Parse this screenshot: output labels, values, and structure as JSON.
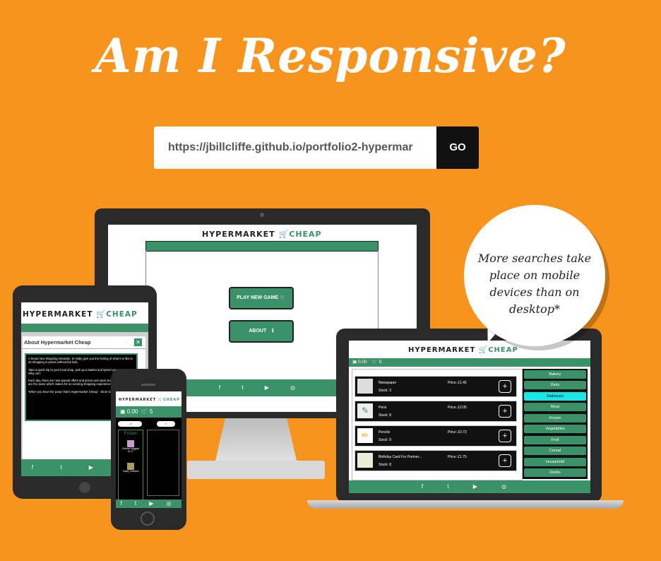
{
  "header": {
    "title": "Am I Responsive?"
  },
  "url_bar": {
    "value": "https://jbillcliffe.github.io/portfolio2-hypermar",
    "go_label": "GO"
  },
  "bubble": {
    "text": "More searches take place on mobile devices than on desktop*"
  },
  "site": {
    "logo_main": "HYPERMARKET",
    "logo_cheap": "CHEAP",
    "play_button": "PLAY NEW GAME",
    "about_button": "ABOUT",
    "footer_icons": "f  t  ▶  ◎"
  },
  "tablet": {
    "modal_title": "About Hypermarket Cheap",
    "modal_p1": "A brand new shopping simulator, to really give you the feeling of what it is like to do shopping in pesos without the kids.",
    "modal_p2": "Take a quick trip to your local shop, pick up a basket and spend your money... Why not?",
    "modal_p3": "Each day, there are new special offers and prices and stock levels. No two days are the same which makes for an exciting shopping experience!",
    "modal_p4": "'When you hear the 'peep' that's Hypermarket Cheap' - Store General Manager"
  },
  "phone": {
    "money": "0.00",
    "cart_count": "5",
    "category": "Frozen",
    "item1": "Chicken Nuggets",
    "item1_price": "£1.47",
    "item2": "Turkey Twizzlers"
  },
  "laptop": {
    "money": "0.00",
    "cart_count": "0",
    "products": [
      {
        "name": "Newspaper",
        "price": "Price: £1.45",
        "stock": "Stock: 3"
      },
      {
        "name": "Pens",
        "price": "Price: £2.05",
        "stock": "Stock: 8"
      },
      {
        "name": "Pencils",
        "price": "Price: £0.73",
        "stock": "Stock: 9"
      },
      {
        "name": "Birthday Card For Partner...",
        "price": "Price: £1.75",
        "stock": "Stock: 8"
      }
    ],
    "categories": [
      "Bakery",
      "Dairy",
      "Stationary",
      "Meat",
      "Frozen",
      "Vegetables",
      "Fruit",
      "Cereal",
      "Household",
      "Drinks"
    ],
    "selected_category": "Stationary"
  }
}
